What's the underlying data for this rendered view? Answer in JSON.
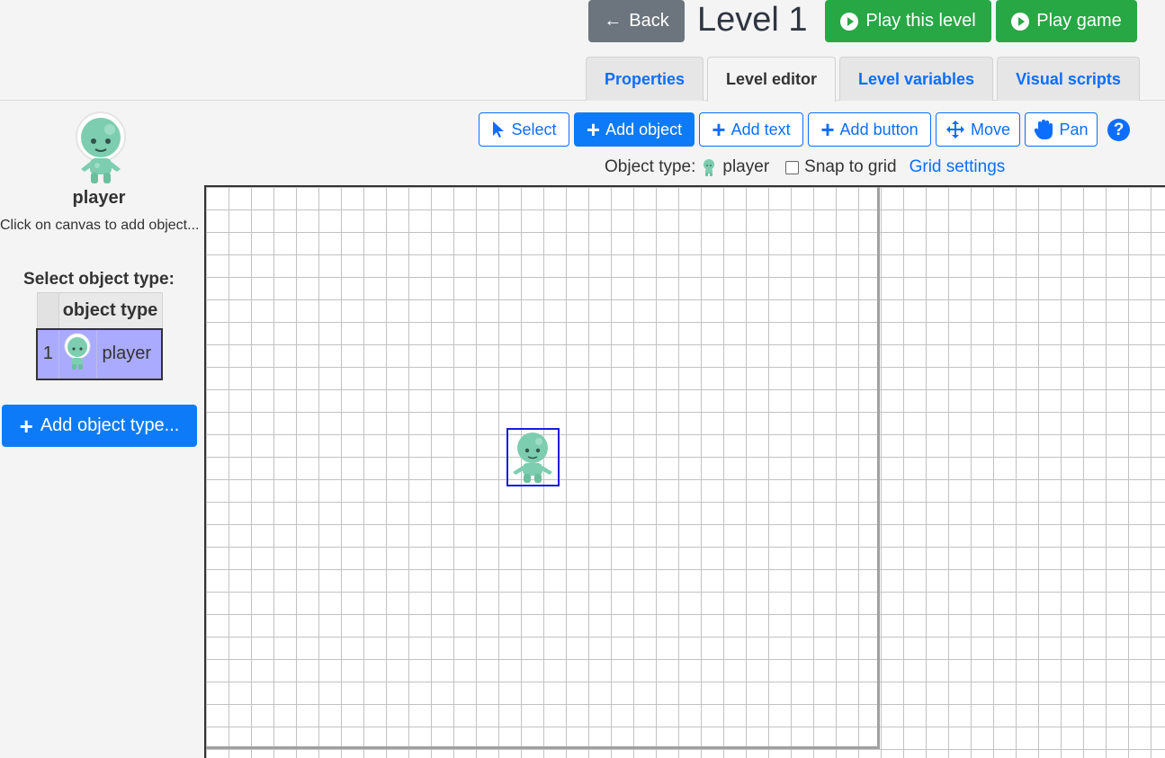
{
  "header": {
    "back_label": "Back",
    "level_title": "Level 1",
    "play_level_label": "Play this level",
    "play_game_label": "Play game"
  },
  "tabs": [
    {
      "label": "Properties",
      "active": false
    },
    {
      "label": "Level editor",
      "active": true
    },
    {
      "label": "Level variables",
      "active": false
    },
    {
      "label": "Visual scripts",
      "active": false
    }
  ],
  "toolbar": {
    "select_label": "Select",
    "add_object_label": "Add object",
    "add_text_label": "Add text",
    "add_button_label": "Add button",
    "move_label": "Move",
    "pan_label": "Pan",
    "help_label": "?",
    "active_tool": "add_object"
  },
  "info": {
    "object_type_label": "Object type:",
    "object_type_value": "player",
    "snap_label": "Snap to grid",
    "snap_checked": false,
    "grid_settings_label": "Grid settings"
  },
  "left_panel": {
    "object_name": "player",
    "hint": "Click on canvas to add object...",
    "select_title": "Select object type:",
    "table_header": "object type",
    "rows": [
      {
        "index": "1",
        "name": "player",
        "selected": true
      }
    ],
    "add_type_label": "Add object type..."
  },
  "colors": {
    "primary": "#0d6efd",
    "success": "#28a745",
    "secondary": "#6c757d",
    "selected_row": "#aaaaff",
    "alien": "#7dcdb0"
  },
  "icons": {
    "back": "arrow-left-icon",
    "play": "play-circle-icon",
    "select": "cursor-icon",
    "add": "plus-icon",
    "move": "move-arrows-icon",
    "pan": "hand-icon",
    "help": "question-circle-icon",
    "sprite": "alien-astronaut-sprite"
  }
}
